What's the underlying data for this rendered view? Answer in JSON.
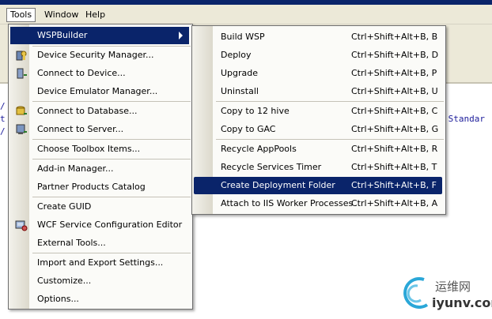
{
  "menubar": {
    "items": [
      "Tools",
      "Window",
      "Help"
    ]
  },
  "code": {
    "line1": "/",
    "line2": "t",
    "line3": "/",
    "suffix": ".Standar"
  },
  "tools_menu": {
    "items": [
      "WSPBuilder",
      "Device Security Manager...",
      "Connect to Device...",
      "Device Emulator Manager...",
      "Connect to Database...",
      "Connect to Server...",
      "Choose Toolbox Items...",
      "Add-in Manager...",
      "Partner Products Catalog",
      "Create GUID",
      "WCF Service Configuration Editor",
      "External Tools...",
      "Import and Export Settings...",
      "Customize...",
      "Options..."
    ]
  },
  "wsp_menu": {
    "items": [
      {
        "label": "Build WSP",
        "shortcut": "Ctrl+Shift+Alt+B, B"
      },
      {
        "label": "Deploy",
        "shortcut": "Ctrl+Shift+Alt+B, D"
      },
      {
        "label": "Upgrade",
        "shortcut": "Ctrl+Shift+Alt+B, P"
      },
      {
        "label": "Uninstall",
        "shortcut": "Ctrl+Shift+Alt+B, U"
      },
      {
        "label": "Copy to 12 hive",
        "shortcut": "Ctrl+Shift+Alt+B, C"
      },
      {
        "label": "Copy to GAC",
        "shortcut": "Ctrl+Shift+Alt+B, G"
      },
      {
        "label": "Recycle AppPools",
        "shortcut": "Ctrl+Shift+Alt+B, R"
      },
      {
        "label": "Recycle Services Timer",
        "shortcut": "Ctrl+Shift+Alt+B, T"
      },
      {
        "label": "Create Deployment Folder",
        "shortcut": "Ctrl+Shift+Alt+B, F"
      },
      {
        "label": "Attach to IIS Worker Processes",
        "shortcut": "Ctrl+Shift+Alt+B, A"
      }
    ]
  },
  "watermark": {
    "cn": "运维网",
    "url": "iyunv.com"
  },
  "colors": {
    "selection": "#0a246a",
    "menubar": "#ece9d8"
  }
}
